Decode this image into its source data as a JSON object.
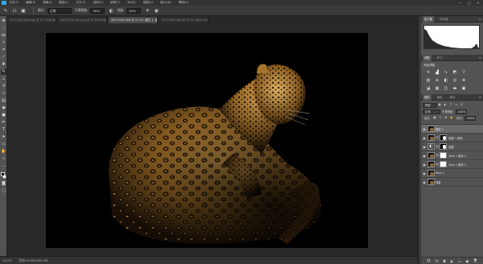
{
  "menu": {
    "items": [
      "文件(F)",
      "编辑(E)",
      "图像(I)",
      "图层(L)",
      "文字(Y)",
      "选择(S)",
      "滤镜(T)",
      "3D(D)",
      "视图(V)",
      "窗口(W)",
      "帮助(H)"
    ],
    "window_controls": [
      "—",
      "□",
      "✕"
    ]
  },
  "options": {
    "size_value": "13",
    "mode_label": "模式:",
    "mode_value": "正常",
    "opacity_label": "不透明度:",
    "opacity_value": "30%",
    "flow_label": "流量:",
    "flow_value": "50%"
  },
  "tabs": [
    {
      "label": "20171014 (98.png) @ 11.7%(RGB/8)",
      "active": false
    },
    {
      "label": "20171014 (99.png) @ 12.5%(RGB/8)",
      "active": false
    },
    {
      "label": "20171016 (99) @ 21.2% (黑白 1, 图层蒙版/8)",
      "active": true
    },
    {
      "label": "20171016 (99) @ 12.4% (Dino 1)",
      "active": false
    }
  ],
  "status": {
    "zoom": "16.5%",
    "doc_size": "文档:29.9M/185.3M"
  },
  "panels": {
    "histogram_tabs": [
      "直方图",
      "导航器"
    ],
    "adjust_tabs": [
      "调整",
      "样式"
    ],
    "adjust_title": "添加调整",
    "layers_tabs": [
      "图层",
      "通道",
      "路径"
    ],
    "kind_label": "类型",
    "blend_mode": "正常",
    "opacity_label": "不透明度:",
    "opacity_value": "100%",
    "lock_label": "锁定:",
    "fill_label": "填充:",
    "fill_value": "100%"
  },
  "layers": [
    {
      "name": "图层 1",
      "thumb": "leo",
      "mask": null,
      "selected": true
    },
    {
      "name": "图层 1 副本",
      "thumb": "leo",
      "mask": "part",
      "selected": false
    },
    {
      "name": "图层",
      "thumb": "adj",
      "mask": "part",
      "selected": false
    },
    {
      "name": "Dino 1 副本 3",
      "thumb": "leo",
      "mask": "white",
      "selected": false
    },
    {
      "name": "Dino 1 副本 2",
      "thumb": "leo",
      "mask": "white",
      "selected": false
    },
    {
      "name": "Dino 1",
      "thumb": "leo",
      "mask": null,
      "selected": false
    },
    {
      "name": "背景",
      "thumb": "leo",
      "mask": null,
      "selected": false
    }
  ],
  "colors": {
    "accent": "#31a8ff",
    "panel_bg": "#535353",
    "canvas_bg": "#282828",
    "leopard_base": "#b8873d"
  }
}
